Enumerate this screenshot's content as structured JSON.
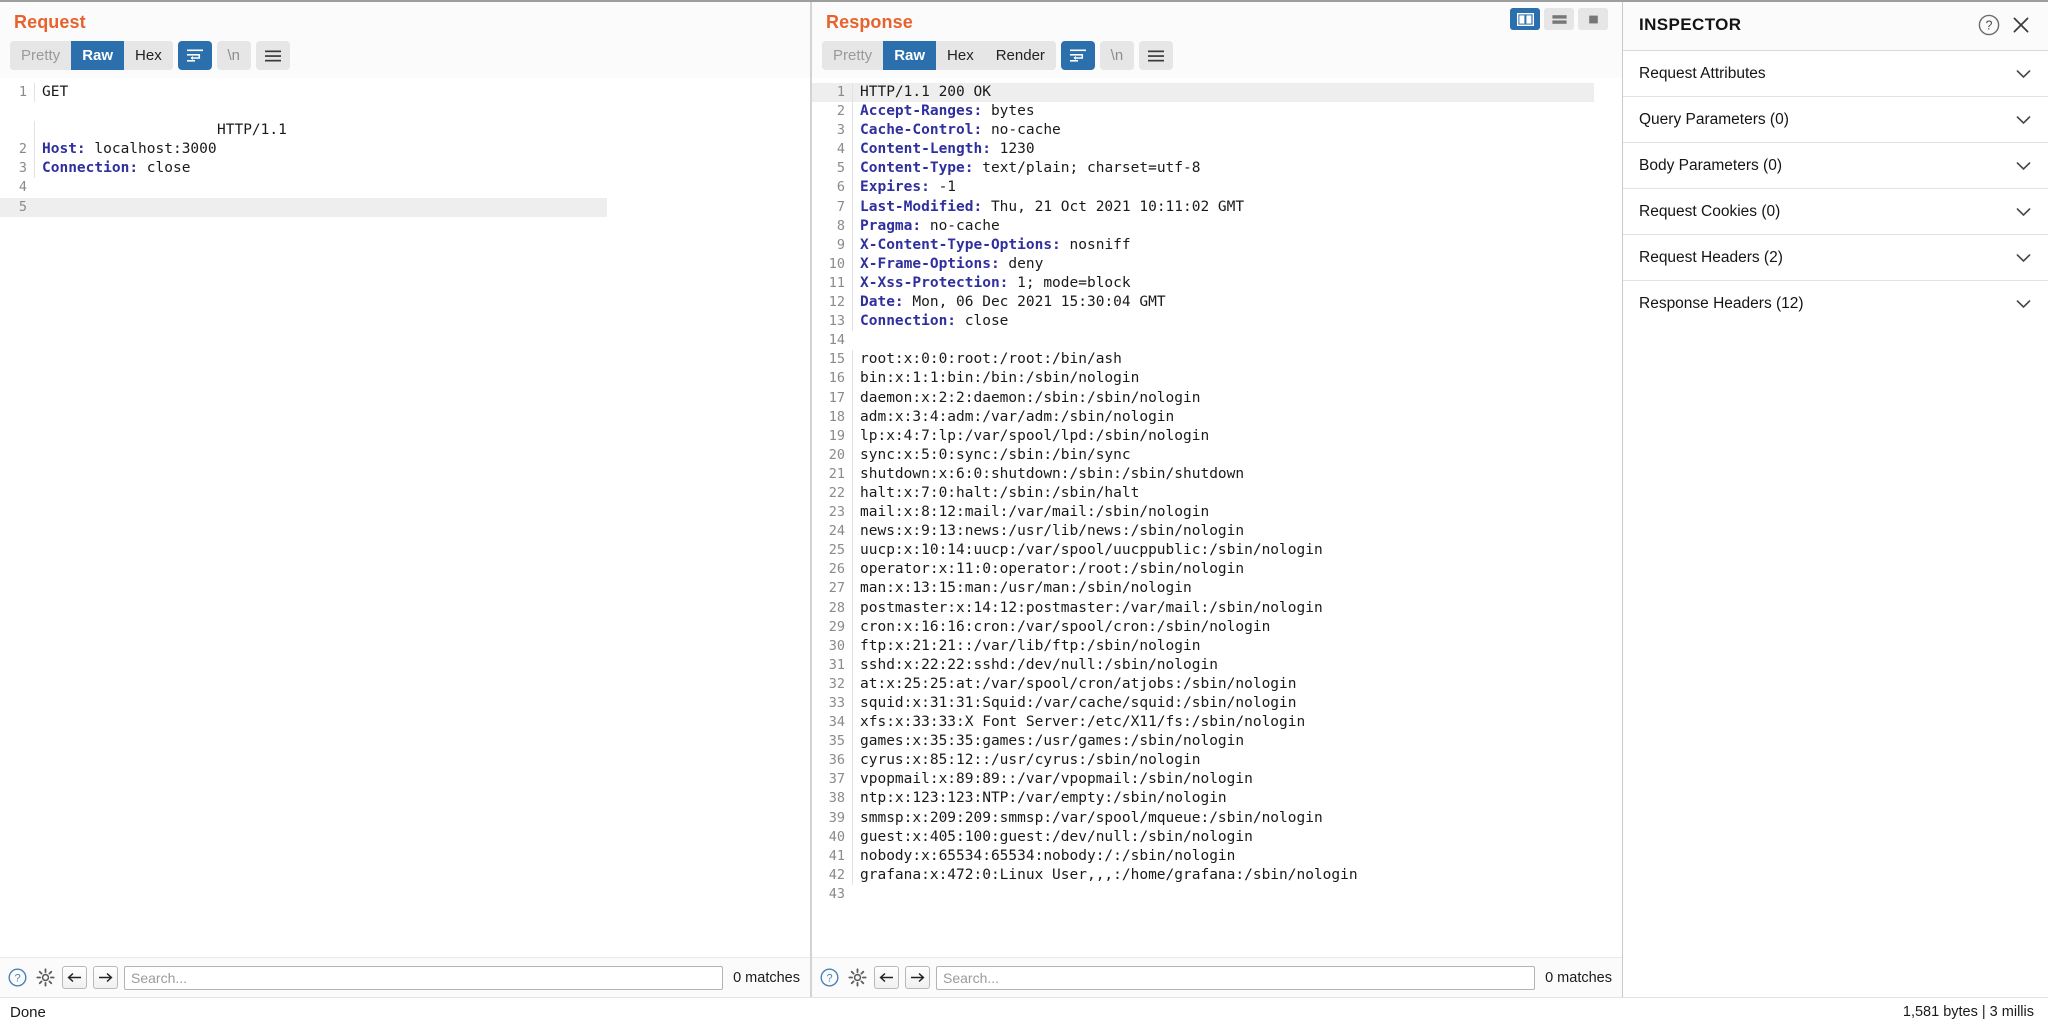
{
  "request_pane": {
    "title": "Request",
    "tabs": [
      {
        "label": "Pretty",
        "state": "dim"
      },
      {
        "label": "Raw",
        "state": "active"
      },
      {
        "label": "Hex",
        "state": "normal"
      }
    ],
    "wrap_icon": "word-wrap-icon",
    "newline_label": "\\n",
    "menu_icon": "hamburger-menu-icon",
    "lines": [
      {
        "no": "1",
        "method": "GET",
        "ghost_path": "",
        "protocol": "HTTP/1.1",
        "type": "request-line",
        "highlight": true
      },
      {
        "no": "2",
        "key": "Host",
        "value": "localhost:3000",
        "type": "header"
      },
      {
        "no": "3",
        "key": "Connection",
        "value": "close",
        "type": "header"
      },
      {
        "no": "4",
        "text": "",
        "type": "blank"
      },
      {
        "no": "5",
        "text": "",
        "type": "blank",
        "highlight": true
      }
    ],
    "footer": {
      "help_icon": "help-circle-icon",
      "settings_icon": "gear-icon",
      "prev_icon": "arrow-left-icon",
      "next_icon": "arrow-right-icon",
      "search_placeholder": "Search...",
      "search_value": "",
      "matches": "0 matches"
    }
  },
  "response_pane": {
    "title": "Response",
    "tabs": [
      {
        "label": "Pretty",
        "state": "dim"
      },
      {
        "label": "Raw",
        "state": "active"
      },
      {
        "label": "Hex",
        "state": "normal"
      },
      {
        "label": "Render",
        "state": "normal"
      }
    ],
    "wrap_icon": "word-wrap-icon",
    "newline_label": "\\n",
    "menu_icon": "hamburger-menu-icon",
    "status_line": "HTTP/1.1 200 OK",
    "headers": [
      {
        "no": "2",
        "key": "Accept-Ranges",
        "value": "bytes"
      },
      {
        "no": "3",
        "key": "Cache-Control",
        "value": "no-cache"
      },
      {
        "no": "4",
        "key": "Content-Length",
        "value": "1230"
      },
      {
        "no": "5",
        "key": "Content-Type",
        "value": "text/plain; charset=utf-8"
      },
      {
        "no": "6",
        "key": "Expires",
        "value": "-1"
      },
      {
        "no": "7",
        "key": "Last-Modified",
        "value": "Thu, 21 Oct 2021 10:11:02 GMT"
      },
      {
        "no": "8",
        "key": "Pragma",
        "value": "no-cache"
      },
      {
        "no": "9",
        "key": "X-Content-Type-Options",
        "value": "nosniff"
      },
      {
        "no": "10",
        "key": "X-Frame-Options",
        "value": "deny"
      },
      {
        "no": "11",
        "key": "X-Xss-Protection",
        "value": "1; mode=block"
      },
      {
        "no": "12",
        "key": "Date",
        "value": "Mon, 06 Dec 2021 15:30:04 GMT"
      },
      {
        "no": "13",
        "key": "Connection",
        "value": "close"
      }
    ],
    "blank_line_no": "14",
    "body": [
      {
        "no": "15",
        "text": "root:x:0:0:root:/root:/bin/ash"
      },
      {
        "no": "16",
        "text": "bin:x:1:1:bin:/bin:/sbin/nologin"
      },
      {
        "no": "17",
        "text": "daemon:x:2:2:daemon:/sbin:/sbin/nologin"
      },
      {
        "no": "18",
        "text": "adm:x:3:4:adm:/var/adm:/sbin/nologin"
      },
      {
        "no": "19",
        "text": "lp:x:4:7:lp:/var/spool/lpd:/sbin/nologin"
      },
      {
        "no": "20",
        "text": "sync:x:5:0:sync:/sbin:/bin/sync"
      },
      {
        "no": "21",
        "text": "shutdown:x:6:0:shutdown:/sbin:/sbin/shutdown"
      },
      {
        "no": "22",
        "text": "halt:x:7:0:halt:/sbin:/sbin/halt"
      },
      {
        "no": "23",
        "text": "mail:x:8:12:mail:/var/mail:/sbin/nologin"
      },
      {
        "no": "24",
        "text": "news:x:9:13:news:/usr/lib/news:/sbin/nologin"
      },
      {
        "no": "25",
        "text": "uucp:x:10:14:uucp:/var/spool/uucppublic:/sbin/nologin"
      },
      {
        "no": "26",
        "text": "operator:x:11:0:operator:/root:/sbin/nologin"
      },
      {
        "no": "27",
        "text": "man:x:13:15:man:/usr/man:/sbin/nologin"
      },
      {
        "no": "28",
        "text": "postmaster:x:14:12:postmaster:/var/mail:/sbin/nologin"
      },
      {
        "no": "29",
        "text": "cron:x:16:16:cron:/var/spool/cron:/sbin/nologin"
      },
      {
        "no": "30",
        "text": "ftp:x:21:21::/var/lib/ftp:/sbin/nologin"
      },
      {
        "no": "31",
        "text": "sshd:x:22:22:sshd:/dev/null:/sbin/nologin"
      },
      {
        "no": "32",
        "text": "at:x:25:25:at:/var/spool/cron/atjobs:/sbin/nologin"
      },
      {
        "no": "33",
        "text": "squid:x:31:31:Squid:/var/cache/squid:/sbin/nologin"
      },
      {
        "no": "34",
        "text": "xfs:x:33:33:X Font Server:/etc/X11/fs:/sbin/nologin"
      },
      {
        "no": "35",
        "text": "games:x:35:35:games:/usr/games:/sbin/nologin"
      },
      {
        "no": "36",
        "text": "cyrus:x:85:12::/usr/cyrus:/sbin/nologin"
      },
      {
        "no": "37",
        "text": "vpopmail:x:89:89::/var/vpopmail:/sbin/nologin"
      },
      {
        "no": "38",
        "text": "ntp:x:123:123:NTP:/var/empty:/sbin/nologin"
      },
      {
        "no": "39",
        "text": "smmsp:x:209:209:smmsp:/var/spool/mqueue:/sbin/nologin"
      },
      {
        "no": "40",
        "text": "guest:x:405:100:guest:/dev/null:/sbin/nologin"
      },
      {
        "no": "41",
        "text": "nobody:x:65534:65534:nobody:/:/sbin/nologin"
      },
      {
        "no": "42",
        "text": "grafana:x:472:0:Linux User,,,:/home/grafana:/sbin/nologin"
      },
      {
        "no": "43",
        "text": ""
      }
    ],
    "footer": {
      "help_icon": "help-circle-icon",
      "settings_icon": "gear-icon",
      "prev_icon": "arrow-left-icon",
      "next_icon": "arrow-right-icon",
      "search_placeholder": "Search...",
      "search_value": "",
      "matches": "0 matches"
    }
  },
  "layout_toggles": [
    {
      "name": "layout-side-by-side",
      "state": "active"
    },
    {
      "name": "layout-stacked",
      "state": "normal"
    },
    {
      "name": "layout-single",
      "state": "normal"
    }
  ],
  "inspector": {
    "title": "INSPECTOR",
    "help_icon": "help-circle-icon",
    "close_icon": "close-icon",
    "sections": [
      {
        "label": "Request Attributes"
      },
      {
        "label": "Query Parameters (0)"
      },
      {
        "label": "Body Parameters (0)"
      },
      {
        "label": "Request Cookies (0)"
      },
      {
        "label": "Request Headers (2)"
      },
      {
        "label": "Response Headers (12)"
      }
    ]
  },
  "status_bar": {
    "left": "Done",
    "right": "1,581 bytes | 3 millis"
  },
  "colors": {
    "accent_orange": "#e8622c",
    "accent_blue": "#2c6fad",
    "header_key_blue": "#2f2f9e"
  }
}
